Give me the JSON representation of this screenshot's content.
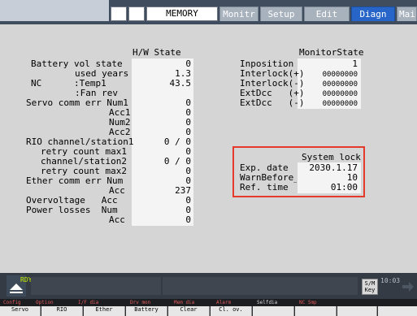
{
  "header": {
    "mode": "MEMORY",
    "tabs": [
      {
        "label": "Monitr",
        "active": false
      },
      {
        "label": "Setup",
        "active": false
      },
      {
        "label": "Edit",
        "active": false
      },
      {
        "label": "Diagn",
        "active": true
      },
      {
        "label": "Mainte",
        "active": false
      }
    ]
  },
  "hw_state": {
    "title": "H/W State",
    "rows": [
      {
        "label": "Battery vol state",
        "value": "0"
      },
      {
        "label": "used years",
        "value": "1.3"
      },
      {
        "label": "NC      :Temp1",
        "value": "43.5"
      },
      {
        "label": ":Fan rev",
        "value": ""
      },
      {
        "label": "Servo comm err Num1",
        "value": "0"
      },
      {
        "label": "Acc1",
        "value": "0"
      },
      {
        "label": "Num2",
        "value": "0"
      },
      {
        "label": "Acc2",
        "value": "0"
      },
      {
        "label": "RIO channel/station1",
        "value": "0 / 0"
      },
      {
        "label": "retry count max1",
        "value": "0"
      },
      {
        "label": "channel/station2",
        "value": "0 / 0"
      },
      {
        "label": "retry count max2",
        "value": "0"
      },
      {
        "label": "Ether comm err Num",
        "value": "0"
      },
      {
        "label": "Acc",
        "value": "237"
      },
      {
        "label": "Overvoltage   Acc",
        "value": "0"
      },
      {
        "label": "Power losses  Num",
        "value": "0"
      },
      {
        "label": "Acc",
        "value": "0"
      }
    ]
  },
  "monitor_state": {
    "title": "MonitorState",
    "rows": [
      {
        "label": "Inposition",
        "value": "1"
      },
      {
        "label": "Interlock(+)",
        "value": "00000000"
      },
      {
        "label": "Interlock(-)",
        "value": "00000000"
      },
      {
        "label": "ExtDcc   (+)",
        "value": "00000000"
      },
      {
        "label": "ExtDcc   (-)",
        "value": "00000000"
      }
    ]
  },
  "system_lock": {
    "title": "System lock",
    "rows": [
      {
        "label": "Exp. date",
        "value": "2030.1.17"
      },
      {
        "label": "WarnBefore_D",
        "value": "10"
      },
      {
        "label": "Ref. time",
        "value": "01:00"
      }
    ]
  },
  "status_bar": {
    "ready": "RDY",
    "key_label_1": "S/M",
    "key_label_2": "Key",
    "clock": "10:03"
  },
  "function_labels": [
    "Config",
    "Option",
    "I/F dia",
    "Drv mon",
    "Mem dia",
    "Alarm",
    "Selfdia",
    "NC Smp"
  ],
  "soft_keys": [
    "Servo",
    "RIO",
    "Ether",
    "Battery",
    "Clear",
    "Cl. ov.",
    "",
    "",
    "",
    ""
  ],
  "colors": {
    "active_tab": "#2766c8",
    "highlight_border": "#e43a2b",
    "ready_text": "#c8f000"
  }
}
